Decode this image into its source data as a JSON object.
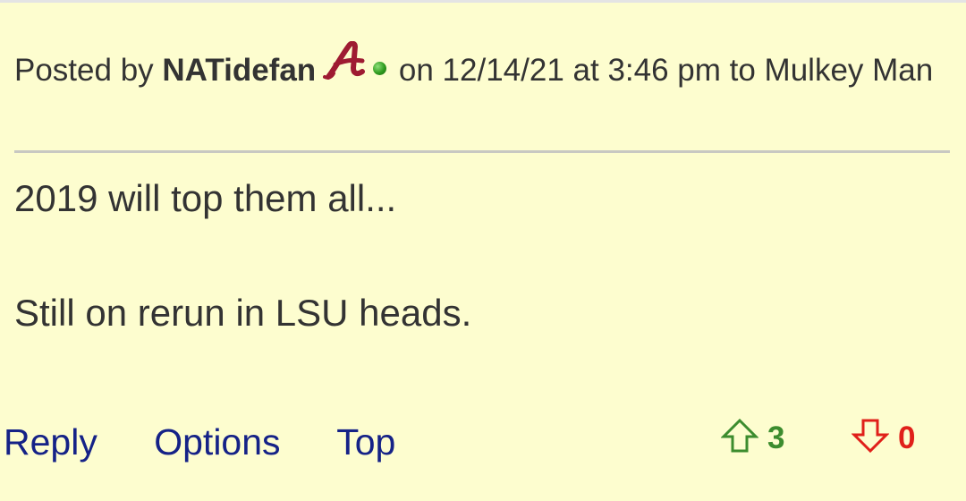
{
  "post": {
    "posted_by_label": "Posted by",
    "author": "NATidefan",
    "team_logo": "alabama-script-a-icon",
    "online_status": "online-indicator-icon",
    "meta_text": "on 12/14/21 at 3:46 pm to Mulkey Man",
    "body_lines": [
      "2019 will top them all...",
      "Still on rerun in LSU heads."
    ]
  },
  "actions": {
    "reply_label": "Reply",
    "options_label": "Options",
    "top_label": "Top"
  },
  "votes": {
    "up_count": "3",
    "down_count": "0",
    "up_color": "#3c8c2e",
    "down_color": "#e0201a"
  },
  "colors": {
    "background": "#fdfdcf",
    "link": "#152287",
    "logo": "#9e1b32"
  }
}
